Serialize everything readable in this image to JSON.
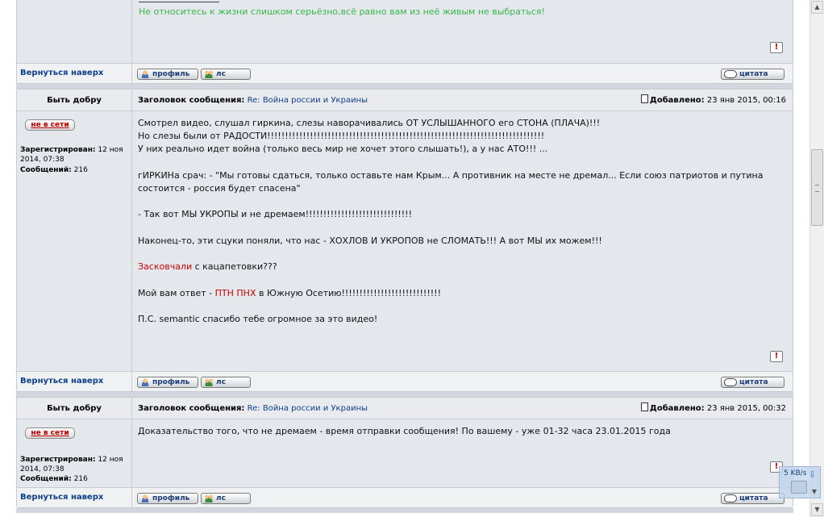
{
  "post_top": {
    "signature": "Не относитесь к жизни слишком серьёзно,всё равно вам из неё живым не выбраться!",
    "footer": {
      "back_to_top": "Вернуться наверх",
      "profile": "профиль",
      "pm": "лс",
      "quote": "цитата"
    }
  },
  "post1": {
    "author": "Быть добру",
    "subject_label": "Заголовок сообщения:",
    "subject": "Re: Война россии и Украины",
    "posted_label": "Добавлено:",
    "posted_date": "23 янв 2015, 00:16",
    "status": "не в сети",
    "registered_label": "Зарегистрирован:",
    "registered_value": "12 ноя",
    "registered_value2": "2014, 07:38",
    "posts_label": "Сообщений:",
    "posts_value": "216",
    "lines": [
      "Смотрел видео, слушал гиркина, слезы наворачивались ОТ УСЛЫШАННОГО его СТОНА (ПЛАЧА)!!!",
      "Но слезы были от РАДОСТИ!!!!!!!!!!!!!!!!!!!!!!!!!!!!!!!!!!!!!!!!!!!!!!!!!!!!!!!!!!!!!!!!!!!!!!!!!!!!!!",
      "У них реально идет война (только весь мир не хочет этого слышать!), а у нас АТО!!! ...",
      "гИРКИНа срач: - \"Мы готовы сдаться, только оставьте нам Крым... А противник на месте не дремал... Если союз патриотов и путина",
      "состоится - россия будет спасена\"",
      "- Так вот МЫ УКРОПЫ и не дремаем!!!!!!!!!!!!!!!!!!!!!!!!!!!!!!",
      "Наконец-то, эти сцуки поняли, что нас - ХОХЛОВ И УКРОПОВ не СЛОМАТЬ!!! А вот МЫ их можем!!!",
      "Засковчали",
      " с кацапетовки???",
      "Мой вам ответ - ",
      "ПТН ПНХ",
      " в Южную Осетию!!!!!!!!!!!!!!!!!!!!!!!!!!!!",
      "П.С. semantic спасибо тебе огромное за это видео!"
    ],
    "footer": {
      "back_to_top": "Вернуться наверх",
      "profile": "профиль",
      "pm": "лс",
      "quote": "цитата"
    }
  },
  "post2": {
    "author": "Быть добру",
    "subject_label": "Заголовок сообщения:",
    "subject": "Re: Война россии и Украины",
    "posted_label": "Добавлено:",
    "posted_date": "23 янв 2015, 00:32",
    "status": "не в сети",
    "registered_label": "Зарегистрирован:",
    "registered_value": "12 ноя",
    "registered_value2": "2014, 07:38",
    "posts_label": "Сообщений:",
    "posts_value": "216",
    "text": "Доказательство того, что не дремаем - время отправки сообщения! По вашему - уже 01-32 часа 23.01.2015 года",
    "footer": {
      "back_to_top": "Вернуться наверх",
      "profile": "профиль",
      "pm": "лс",
      "quote": "цитата"
    }
  },
  "tray": {
    "speed": "5 KB/s"
  },
  "colors": {
    "link": "#0e3f8c",
    "signature": "#37b84a",
    "highlight": "#cc0000",
    "offline": "#c00000"
  }
}
